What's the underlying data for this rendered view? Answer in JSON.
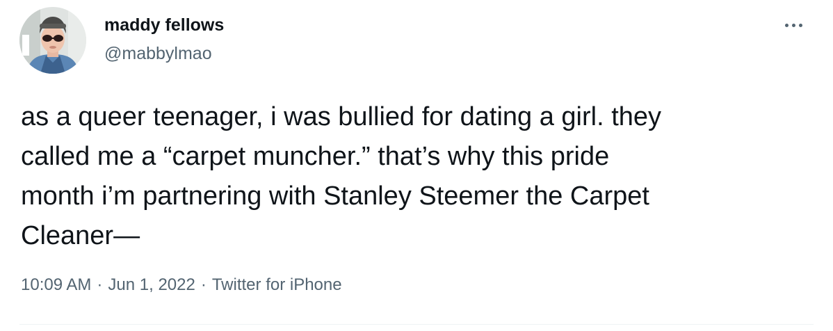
{
  "author": {
    "display_name": "maddy fellows",
    "handle": "@mabbylmao",
    "avatar_icon": "user-avatar-photo"
  },
  "more_menu": {
    "icon": "more-horizontal-icon"
  },
  "tweet": {
    "lines": [
      "as a queer teenager, i was bullied for dating a girl. they",
      "called me a “carpet muncher.” that’s why this pride",
      "month i’m partnering with Stanley Steemer the Carpet",
      "Cleaner—"
    ]
  },
  "meta": {
    "time": "10:09 AM",
    "date": "Jun 1, 2022",
    "source": "Twitter for iPhone",
    "separator": "·"
  },
  "colors": {
    "text_primary": "#0f1419",
    "text_secondary": "#536471",
    "divider": "#eff3f4",
    "background": "#ffffff"
  }
}
